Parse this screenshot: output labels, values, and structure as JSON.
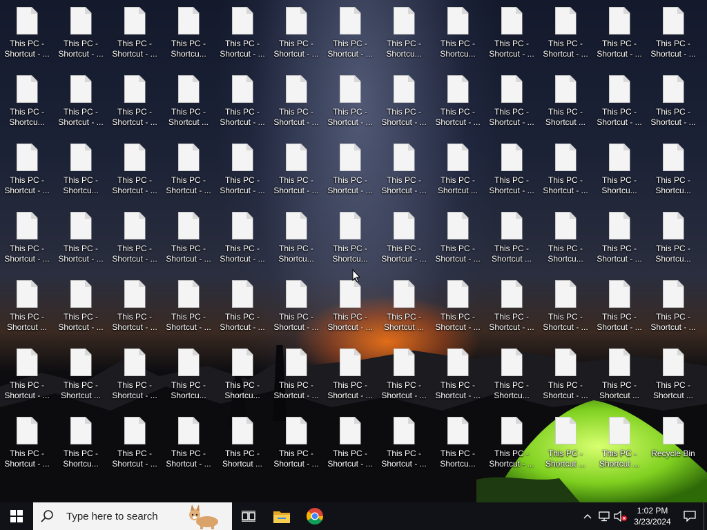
{
  "desktop": {
    "rows": [
      [
        "This PC - Shortcut - ...",
        "This PC - Shortcut - ...",
        "This PC - Shortcut - ...",
        "This PC - Shortcu...",
        "This PC - Shortcut - ...",
        "This PC - Shortcut - ...",
        "This PC - Shortcut - ...",
        "This PC - Shortcu...",
        "This PC - Shortcu...",
        "This PC - Shortcut - ...",
        "This PC - Shortcut - ...",
        "This PC - Shortcut - ...",
        "This PC - Shortcut - ..."
      ],
      [
        "This PC - Shortcu...",
        "This PC - Shortcut - ...",
        "This PC - Shortcut - ...",
        "This PC - Shortcut ...",
        "This PC - Shortcut - ...",
        "This PC - Shortcut - ...",
        "This PC - Shortcut - ...",
        "This PC - Shortcut - ...",
        "This PC - Shortcut - ...",
        "This PC - Shortcut - ...",
        "This PC - Shortcut ...",
        "This PC - Shortcut - ...",
        "This PC - Shortcut - ..."
      ],
      [
        "This PC - Shortcut - ...",
        "This PC - Shortcu...",
        "This PC - Shortcut - ...",
        "This PC - Shortcut - ...",
        "This PC - Shortcut - ...",
        "This PC - Shortcut - ...",
        "This PC - Shortcut - ...",
        "This PC - Shortcut - ...",
        "This PC - Shortcut ...",
        "This PC - Shortcut - ...",
        "This PC - Shortcut - ...",
        "This PC - Shortcu...",
        "This PC - Shortcu..."
      ],
      [
        "This PC - Shortcut - ...",
        "This PC - Shortcut - ...",
        "This PC - Shortcut - ...",
        "This PC - Shortcut - ...",
        "This PC - Shortcut - ...",
        "This PC - Shortcu...",
        "This PC - Shortcu...",
        "This PC - Shortcut - ...",
        "This PC - Shortcut - ...",
        "This PC - Shortcut ...",
        "This PC - Shortcu...",
        "This PC - Shortcut - ...",
        "This PC - Shortcu..."
      ],
      [
        "This PC - Shortcut ...",
        "This PC - Shortcut - ...",
        "This PC - Shortcut - ...",
        "This PC - Shortcut - ...",
        "This PC - Shortcut - ...",
        "This PC - Shortcut - ...",
        "This PC - Shortcut - ...",
        "This PC - Shortcut ...",
        "This PC - Shortcut - ...",
        "This PC - Shortcut - ...",
        "This PC - Shortcut - ...",
        "This PC - Shortcut - ...",
        "This PC - Shortcut - ..."
      ],
      [
        "This PC - Shortcut - ...",
        "This PC - Shortcut ...",
        "This PC - Shortcut - ...",
        "This PC - Shortcu...",
        "This PC - Shortcu...",
        "This PC - Shortcut - ...",
        "This PC - Shortcut - ...",
        "This PC - Shortcut - ...",
        "This PC - Shortcut - ...",
        "This PC - Shortcu...",
        "This PC - Shortcut - ...",
        "This PC - Shortcut ...",
        "This PC - Shortcut ..."
      ],
      [
        "This PC - Shortcut - ...",
        "This PC - Shortcu...",
        "This PC - Shortcut - ...",
        "This PC - Shortcut - ...",
        "This PC - Shortcut ...",
        "This PC - Shortcut - ...",
        "This PC - Shortcut - ...",
        "This PC - Shortcut - ...",
        "This PC - Shortcu...",
        "This PC - Shortcut - ...",
        "This PC - Shortcut ...",
        "This PC - Shortcut ...",
        "Recycle Bin"
      ]
    ]
  },
  "taskbar": {
    "search_placeholder": "Type here to search",
    "time": "1:02 PM",
    "date": "3/23/2024",
    "pinned": [
      "Task View",
      "File Explorer",
      "Google Chrome"
    ]
  },
  "colors": {
    "taskbar_bg": "#101217",
    "search_bg": "#f3f3f3",
    "chrome_red": "#db4437",
    "chrome_yellow": "#f4b400",
    "chrome_green": "#0f9d58",
    "chrome_blue": "#4285f4",
    "folder": "#f0c040"
  }
}
